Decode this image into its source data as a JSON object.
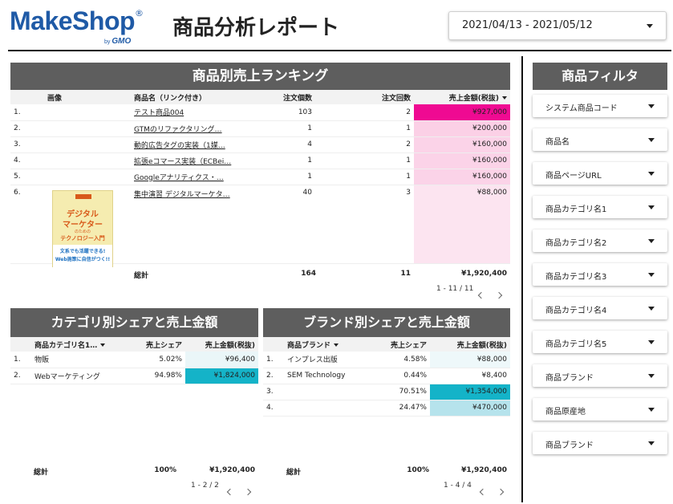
{
  "logo": {
    "brand": "MakeShop",
    "reg": "®",
    "by": "by",
    "gmo": "GMO"
  },
  "header": {
    "title": "商品分析レポート",
    "date_range": "2021/04/13 - 2021/05/12"
  },
  "ranking": {
    "title": "商品別売上ランキング",
    "columns": [
      "画像",
      "商品名（リンク付き）",
      "注文個数",
      "注文回数",
      "売上金額(税抜)"
    ],
    "rows": [
      {
        "rank": "1.",
        "name": "テスト商品004",
        "qty": "103",
        "orders": "2",
        "sales": "¥927,000",
        "heat": "#ef0a92"
      },
      {
        "rank": "2.",
        "name": "GTMのリファクタリング…",
        "qty": "1",
        "orders": "1",
        "sales": "¥200,000",
        "heat": "#fbd0e6"
      },
      {
        "rank": "3.",
        "name": "動的広告タグの実装（1媒…",
        "qty": "4",
        "orders": "2",
        "sales": "¥160,000",
        "heat": "#fbd3e8"
      },
      {
        "rank": "4.",
        "name": "拡張eコマース実装（ECBei…",
        "qty": "1",
        "orders": "1",
        "sales": "¥160,000",
        "heat": "#fbd3e8"
      },
      {
        "rank": "5.",
        "name": "Googleアナリティクス・…",
        "qty": "1",
        "orders": "1",
        "sales": "¥160,000",
        "heat": "#fbd3e8"
      },
      {
        "rank": "6.",
        "name": "集中演習 デジタルマーケタ…",
        "qty": "40",
        "orders": "3",
        "sales": "¥88,000",
        "heat": "#fce4f0"
      }
    ],
    "total": {
      "label": "総計",
      "qty": "164",
      "orders": "11",
      "sales": "¥1,920,400"
    },
    "pager": "1 - 11 / 11",
    "book": {
      "badge": "集中演習",
      "line1": "デジタル",
      "line2": "マーケター",
      "line3": "のための",
      "line4": "テクノロジー入門",
      "line5": "文系でも活躍できる!",
      "line6": "Web施策に自信がつく!!"
    }
  },
  "category": {
    "title": "カテゴリ別シェアと売上金額",
    "columns": [
      "商品カテゴリ名1…",
      "売上シェア",
      "売上金額(税抜)"
    ],
    "rows": [
      {
        "rank": "1.",
        "name": "物販",
        "share": "5.02%",
        "sales": "¥96,400",
        "heat": "#eaf6f8"
      },
      {
        "rank": "2.",
        "name": "Webマーケティング",
        "share": "94.98%",
        "sales": "¥1,824,000",
        "heat": "#14b3c8"
      }
    ],
    "total": {
      "label": "総計",
      "share": "100%",
      "sales": "¥1,920,400"
    },
    "pager": "1 - 2 / 2"
  },
  "brand": {
    "title": "ブランド別シェアと売上金額",
    "columns": [
      "商品ブランド",
      "売上シェア",
      "売上金額(税抜)"
    ],
    "rows": [
      {
        "rank": "1.",
        "name": "インプレス出版",
        "share": "4.58%",
        "sales": "¥88,000",
        "heat": "#eef8fa"
      },
      {
        "rank": "2.",
        "name": "SEM Technology",
        "share": "0.44%",
        "sales": "¥8,400",
        "heat": "#ffffff"
      },
      {
        "rank": "3.",
        "name": "",
        "share": "70.51%",
        "sales": "¥1,354,000",
        "heat": "#14b3c8"
      },
      {
        "rank": "4.",
        "name": "",
        "share": "24.47%",
        "sales": "¥470,000",
        "heat": "#b6e3ec"
      }
    ],
    "total": {
      "label": "総計",
      "share": "100%",
      "sales": "¥1,920,400"
    },
    "pager": "1 - 4 / 4"
  },
  "filters": {
    "title": "商品フィルタ",
    "items": [
      "システム商品コード",
      "商品名",
      "商品ページURL",
      "商品カテゴリ名1",
      "商品カテゴリ名2",
      "商品カテゴリ名3",
      "商品カテゴリ名4",
      "商品カテゴリ名5",
      "商品ブランド",
      "商品原産地",
      "商品ブランド"
    ]
  }
}
